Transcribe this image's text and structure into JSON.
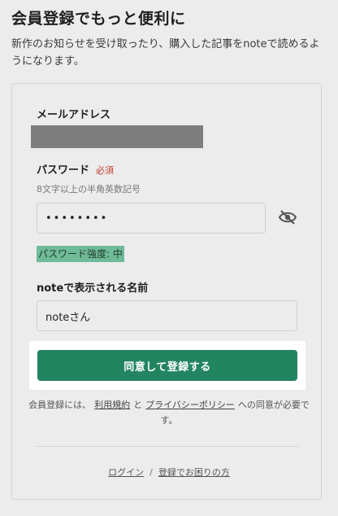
{
  "header": {
    "title": "会員登録でもっと便利に",
    "description": "新作のお知らせを受け取ったり、購入した記事をnoteで読めるようになります。"
  },
  "form": {
    "email_label": "メールアドレス",
    "password_label": "パスワード",
    "password_required": "必須",
    "password_hint": "8文字以上の半角英数記号",
    "password_value": "••••••••",
    "password_toggle_icon": "eye-slash-icon",
    "password_strength": "パスワード強度: 中",
    "name_label": "noteで表示される名前",
    "name_value": "noteさん",
    "submit_label": "同意して登録する"
  },
  "consent": {
    "prefix": "会員登録には、",
    "terms_link": "利用規約",
    "and": "と",
    "privacy_link": "プライバシーポリシー",
    "suffix": "への同意が必要です。"
  },
  "footer": {
    "login_link": "ログイン",
    "separator": "/",
    "help_link": "登録でお困りの方"
  },
  "colors": {
    "accent": "#238461",
    "strength_bg": "#6fba98",
    "required": "#c0392b"
  }
}
